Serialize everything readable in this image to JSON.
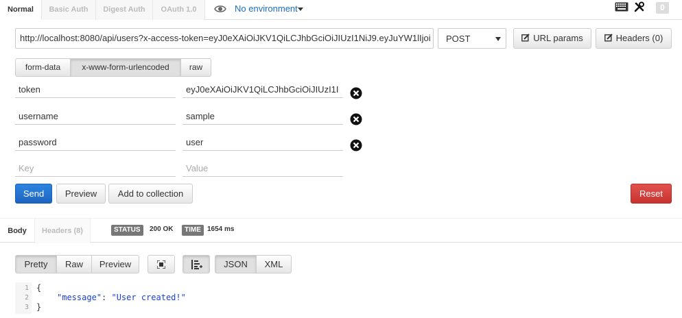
{
  "auth_tabs": [
    {
      "label": "Normal",
      "active": true
    },
    {
      "label": "Basic Auth",
      "active": false
    },
    {
      "label": "Digest Auth",
      "active": false
    },
    {
      "label": "OAuth 1.0",
      "active": false
    }
  ],
  "environment": {
    "label": "No environment",
    "icon": "eye-icon"
  },
  "header_counter": "0",
  "request": {
    "url": "http://localhost:8080/api/users?x-access-token=eyJ0eXAiOiJKV1QiLCJhbGciOiJIUzI1NiJ9.eyJuYW1lIjoi",
    "method": "POST",
    "url_params_label": "URL params",
    "headers_label": "Headers (0)"
  },
  "body_tabs": [
    {
      "label": "form-data",
      "active": false
    },
    {
      "label": "x-www-form-urlencoded",
      "active": true
    },
    {
      "label": "raw",
      "active": false
    }
  ],
  "form_rows": [
    {
      "key": "token",
      "value": "eyJ0eXAiOiJKV1QiLCJhbGciOiJIUzI1I"
    },
    {
      "key": "username",
      "value": "sample"
    },
    {
      "key": "password",
      "value": "user"
    }
  ],
  "new_row": {
    "key_placeholder": "Key",
    "value_placeholder": "Value"
  },
  "actions": {
    "send": "Send",
    "preview": "Preview",
    "add_to_collection": "Add to collection",
    "reset": "Reset"
  },
  "response": {
    "tabs": [
      {
        "label": "Body",
        "active": true
      },
      {
        "label": "Headers (8)",
        "active": false
      }
    ],
    "status_label": "STATUS",
    "status_value": "200 OK",
    "time_label": "TIME",
    "time_value": "1654 ms",
    "view_modes": [
      "Pretty",
      "Raw",
      "Preview"
    ],
    "formats": [
      "JSON",
      "XML"
    ],
    "code_lines": [
      {
        "num": "1",
        "text": "{"
      },
      {
        "num": "2",
        "key": "\"message\"",
        "sep": ": ",
        "value": "\"User created!\""
      },
      {
        "num": "3",
        "text": "}"
      }
    ]
  },
  "colors": {
    "accent": "#1a6dc1",
    "send": "#2d85e0",
    "reset": "#d9534f"
  }
}
